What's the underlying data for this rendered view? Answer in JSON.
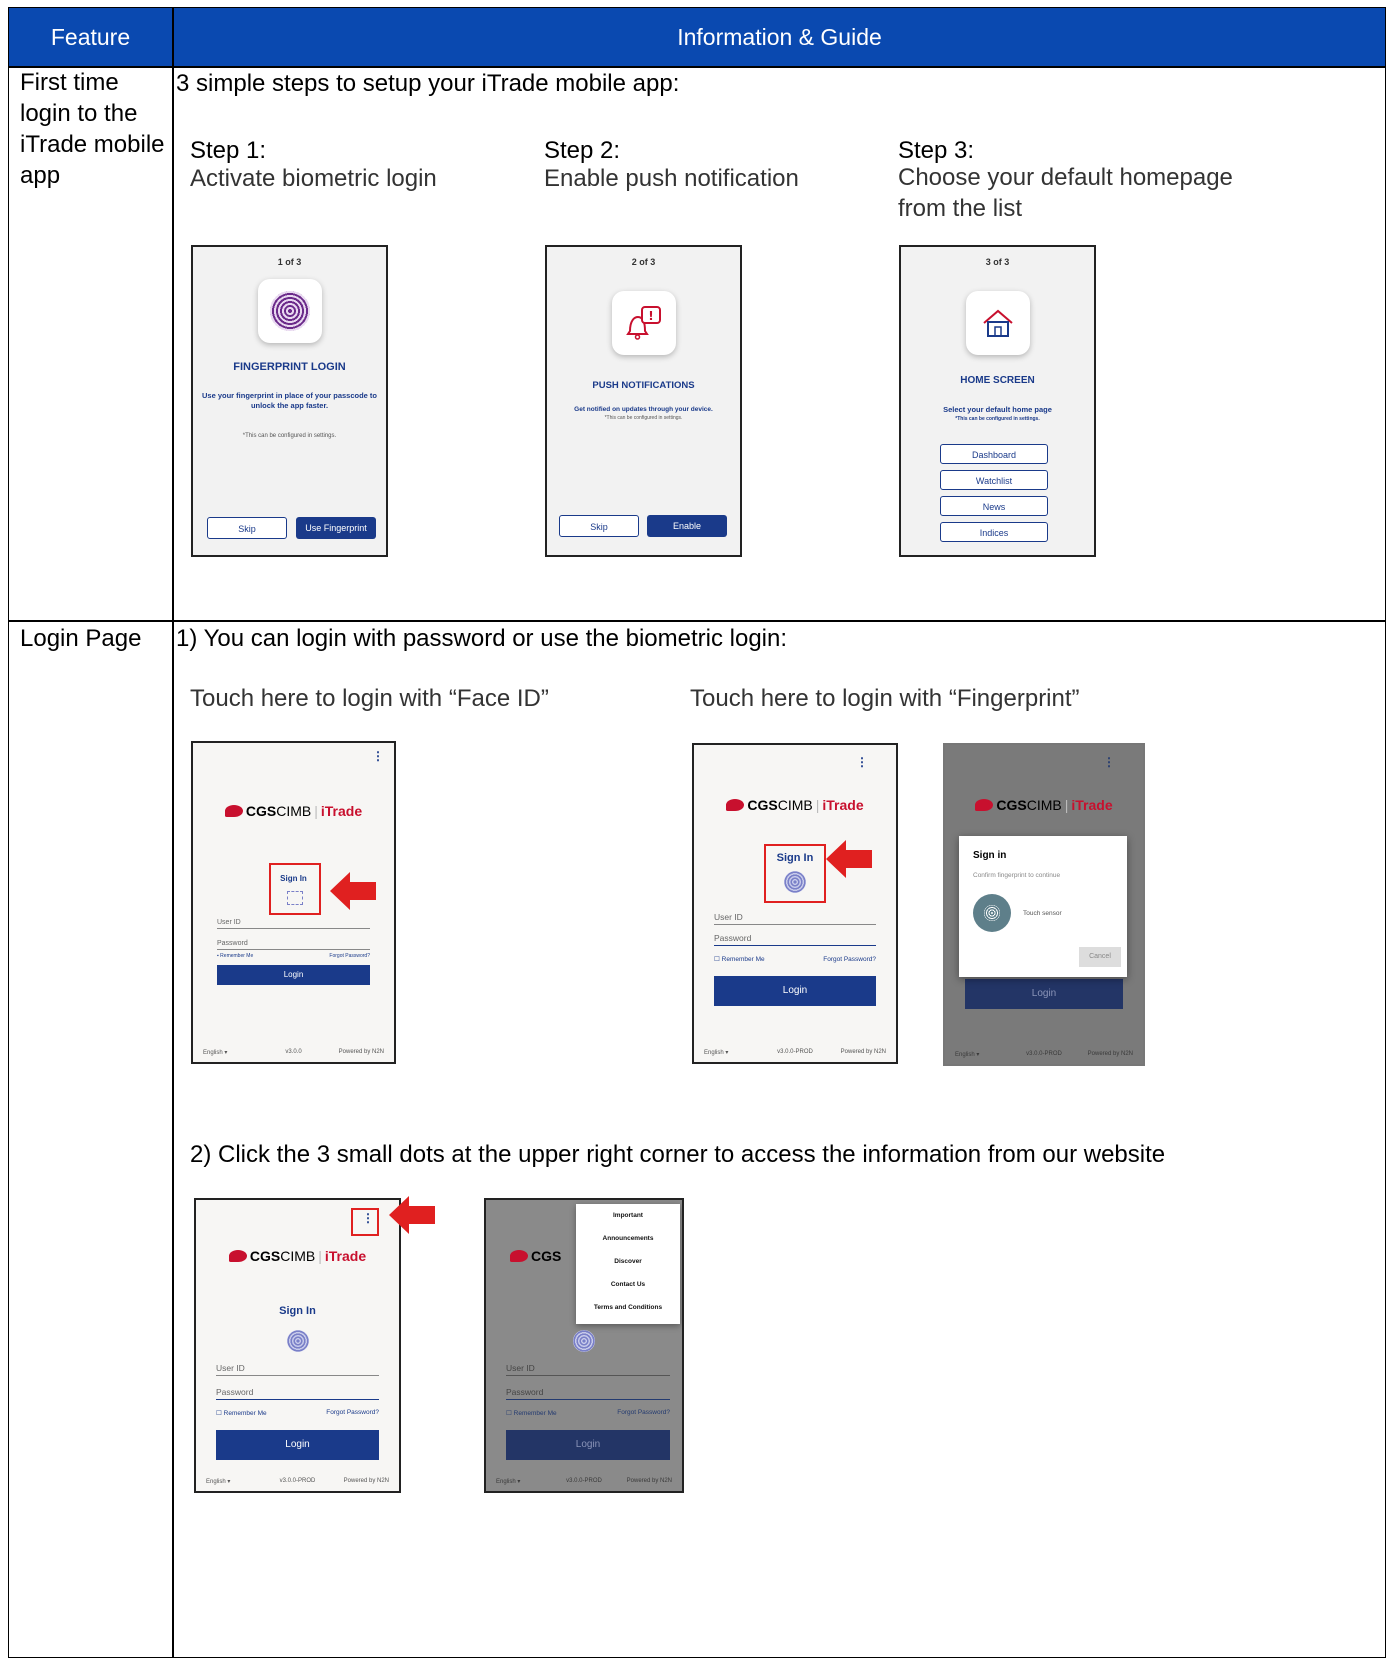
{
  "header": {
    "feature_label": "Feature",
    "info_label": "Information & Guide"
  },
  "row1": {
    "feature": "First time login to the iTrade mobile app",
    "intro": "3 simple steps to setup your iTrade mobile app:",
    "steps": [
      {
        "title": "Step 1:",
        "desc": "Activate biometric login"
      },
      {
        "title": "Step 2:",
        "desc": "Enable push notification"
      },
      {
        "title": "Step 3:",
        "desc": "Choose your default homepage from the list"
      }
    ],
    "screens": [
      {
        "counter": "1 of 3",
        "title": "FINGERPRINT LOGIN",
        "desc": "Use your fingerprint in place of your passcode to unlock the app faster.",
        "note": "*This can be configured in settings.",
        "btn_left": "Skip",
        "btn_right": "Use Fingerprint"
      },
      {
        "counter": "2 of 3",
        "title": "PUSH NOTIFICATIONS",
        "desc": "Get notified on updates through your device.",
        "note": "*This can be configured in settings.",
        "btn_left": "Skip",
        "btn_right": "Enable"
      },
      {
        "counter": "3 of 3",
        "title": "HOME SCREEN",
        "desc": "Select your default home page",
        "note": "*This can be configured in settings.",
        "options": [
          "Dashboard",
          "Watchlist",
          "News",
          "Indices"
        ]
      }
    ]
  },
  "row2": {
    "feature": "Login Page",
    "point1": "1)  You can login with password or use the biometric login:",
    "faceid_caption": "Touch here to login with “Face ID”",
    "fingerprint_caption": "Touch here to login with “Fingerprint”",
    "point2": "2)  Click the 3 small dots at the upper right corner to access the information from our website",
    "login_screen": {
      "logo_cgs": "CGS",
      "logo_cimb": "CIMB",
      "logo_sep": "|",
      "logo_itrade": "iTrade",
      "sign_in": "Sign In",
      "user_id": "User ID",
      "password": "Password",
      "remember": "Remember Me",
      "forgot": "Forgot Password?",
      "login": "Login",
      "lang": "English",
      "version_a": "v3.0.0",
      "version_b": "v3.0.0-PROD",
      "powered": "Powered by N2N"
    },
    "fp_dialog": {
      "title": "Sign in",
      "subtitle": "Confirm fingerprint to continue",
      "sensor": "Touch sensor",
      "cancel": "Cancel"
    },
    "menu": [
      "Important",
      "Announcements",
      "Discover",
      "Contact Us",
      "Terms and Conditions"
    ]
  },
  "colors": {
    "header_bg": "#0a49b0",
    "brand_navy": "#1a3a8a",
    "brand_red": "#c8102e",
    "callout_red": "#e02020"
  }
}
